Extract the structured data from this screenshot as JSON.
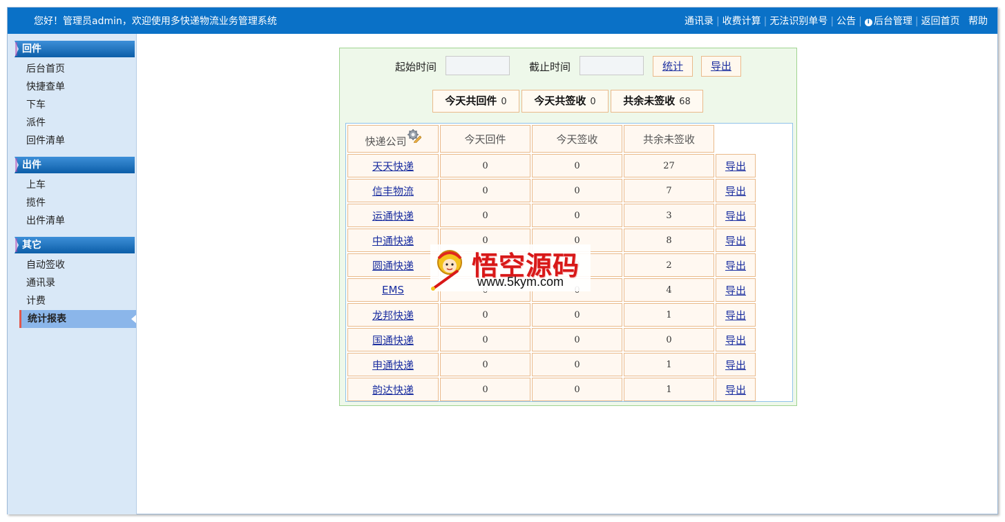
{
  "header": {
    "greeting": "您好！管理员admin，欢迎使用多快递物流业务管理系统",
    "links": [
      "通讯录",
      "收费计算",
      "无法识别单号",
      "公告",
      "后台管理",
      "返回首页",
      "帮助"
    ]
  },
  "sidebar": {
    "sections": [
      {
        "title": "回件",
        "items": [
          "后台首页",
          "快捷查单",
          "下车",
          "派件",
          "回件清单"
        ]
      },
      {
        "title": "出件",
        "items": [
          "上车",
          "揽件",
          "出件清单"
        ]
      },
      {
        "title": "其它",
        "items": [
          "自动签收",
          "通讯录",
          "计费",
          "统计报表"
        ]
      }
    ],
    "active_item": "统计报表"
  },
  "filter": {
    "start_label": "起始时间",
    "start_value": "",
    "end_label": "截止时间",
    "end_value": "",
    "stat_button": "统计",
    "export_button": "导出"
  },
  "summary": {
    "today_return_label": "今天共回件",
    "today_return_value": "0",
    "today_signed_label": "今天共签收",
    "today_signed_value": "0",
    "remaining_label": "共余未签收",
    "remaining_value": "68"
  },
  "table": {
    "headers": [
      "快递公司",
      "今天回件",
      "今天签收",
      "共余未签收"
    ],
    "export_label": "导出",
    "rows": [
      {
        "company": "天天快递",
        "returned": "0",
        "signed": "0",
        "unsigned": "27"
      },
      {
        "company": "信丰物流",
        "returned": "0",
        "signed": "0",
        "unsigned": "7"
      },
      {
        "company": "运通快递",
        "returned": "0",
        "signed": "0",
        "unsigned": "3"
      },
      {
        "company": "中通快递",
        "returned": "0",
        "signed": "0",
        "unsigned": "8"
      },
      {
        "company": "圆通快递",
        "returned": "0",
        "signed": "0",
        "unsigned": "2"
      },
      {
        "company": "EMS",
        "returned": "0",
        "signed": "0",
        "unsigned": "4"
      },
      {
        "company": "龙邦快递",
        "returned": "0",
        "signed": "0",
        "unsigned": "1"
      },
      {
        "company": "国通快递",
        "returned": "0",
        "signed": "0",
        "unsigned": "0"
      },
      {
        "company": "申通快递",
        "returned": "0",
        "signed": "0",
        "unsigned": "1"
      },
      {
        "company": "韵达快递",
        "returned": "0",
        "signed": "0",
        "unsigned": "1"
      }
    ]
  },
  "watermark": {
    "title": "悟空源码",
    "url": "www.5kym.com"
  },
  "colors": {
    "topbar": "#0a71c7",
    "sidebar_bg": "#d9e8f7",
    "panel_bg": "#eef8ea",
    "cell_border": "#e9b98a",
    "link": "#1a2ea0",
    "active_marker": "#e2564a"
  }
}
